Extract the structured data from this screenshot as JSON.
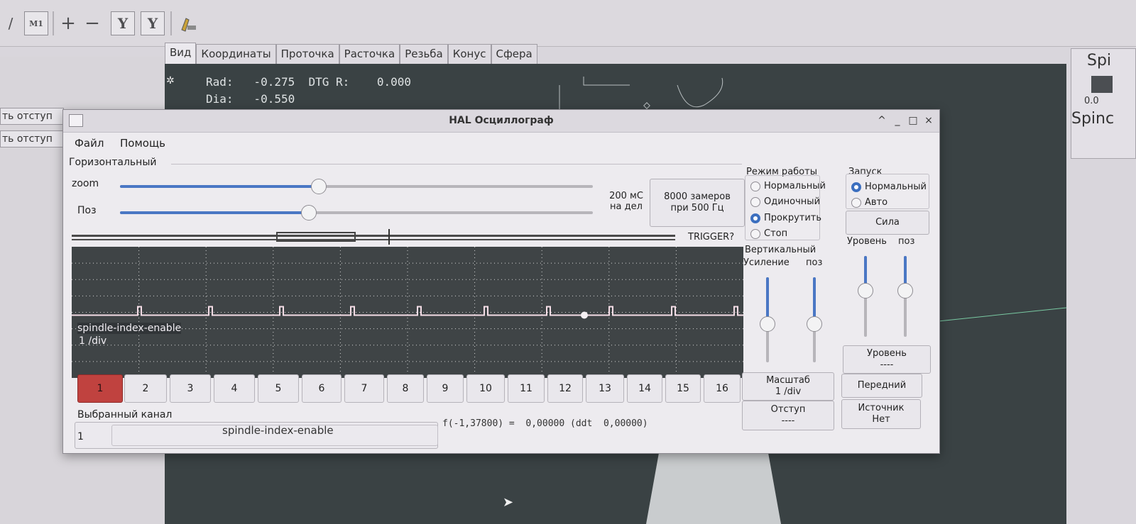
{
  "background": {
    "tabs": [
      "Вид",
      "Координаты",
      "Проточка",
      "Расточка",
      "Резьба",
      "Конус",
      "Сфера"
    ],
    "active_tab": "Вид",
    "dro_line1": "Rad:   -0.275  DTG R:    0.000",
    "dro_line2": "Dia:   -0.550",
    "left_buttons": [
      "ть отступ",
      "ть отступ"
    ],
    "toolbar_glyphs": [
      "/",
      "M1",
      "+",
      "−",
      "Y",
      "Y"
    ],
    "right_panel": {
      "title1": "Spi",
      "value": "0.0",
      "title2": "Spinc"
    }
  },
  "window": {
    "title": "HAL Осциллограф",
    "menu": [
      "Файл",
      "Помощь"
    ],
    "controls": [
      "^",
      "_",
      "□",
      "×"
    ]
  },
  "horizontal": {
    "label": "Горизонтальный",
    "zoom_label": "zoom",
    "pos_label": "Поз",
    "zoom_level": 0.42,
    "pos_level": 0.4,
    "timebase_line1": "200 мС",
    "timebase_line2": "на дел",
    "samples_line1": "8000 замеров",
    "samples_line2": "при 500 Гц",
    "trigger_label": "TRIGGER?"
  },
  "trace": {
    "name": "spindle-index-enable",
    "scale": "1 /div",
    "color": "#f4dde6",
    "grid_color": "#3f4446"
  },
  "channels": [
    "1",
    "2",
    "3",
    "4",
    "5",
    "6",
    "7",
    "8",
    "9",
    "10",
    "11",
    "12",
    "13",
    "14",
    "15",
    "16"
  ],
  "active_channel": "1",
  "selected": {
    "label": "Выбранный канал",
    "number": "1",
    "name": "spindle-index-enable",
    "readout": "f(-1,37800) =  0,00000 (ddt  0,00000)"
  },
  "mode": {
    "label": "Режим работы",
    "options": [
      "Нормальный",
      "Одиночный",
      "Прокрутить",
      "Стоп"
    ],
    "selected": "Прокрутить"
  },
  "vertical": {
    "label": "Вертикальный",
    "gain_label": "Усиление",
    "pos_label": "поз",
    "gain_level": 0.55,
    "pos_level": 0.55,
    "scale_line1": "Масштаб",
    "scale_line2": "1 /div",
    "offset_label": "Отступ",
    "offset_value": "----"
  },
  "run": {
    "label": "Запуск",
    "options": [
      "Нормальный",
      "Авто"
    ],
    "selected": "Нормальный",
    "force_button": "Сила",
    "level_label": "Уровень",
    "pos_label": "поз",
    "level_value_label": "Уровень",
    "level_value": "----",
    "edge_button": "Передний",
    "source_line1": "Источник",
    "source_line2": "Нет"
  },
  "accent_color": "#3c6fbf",
  "active_channel_color": "#c0423f"
}
